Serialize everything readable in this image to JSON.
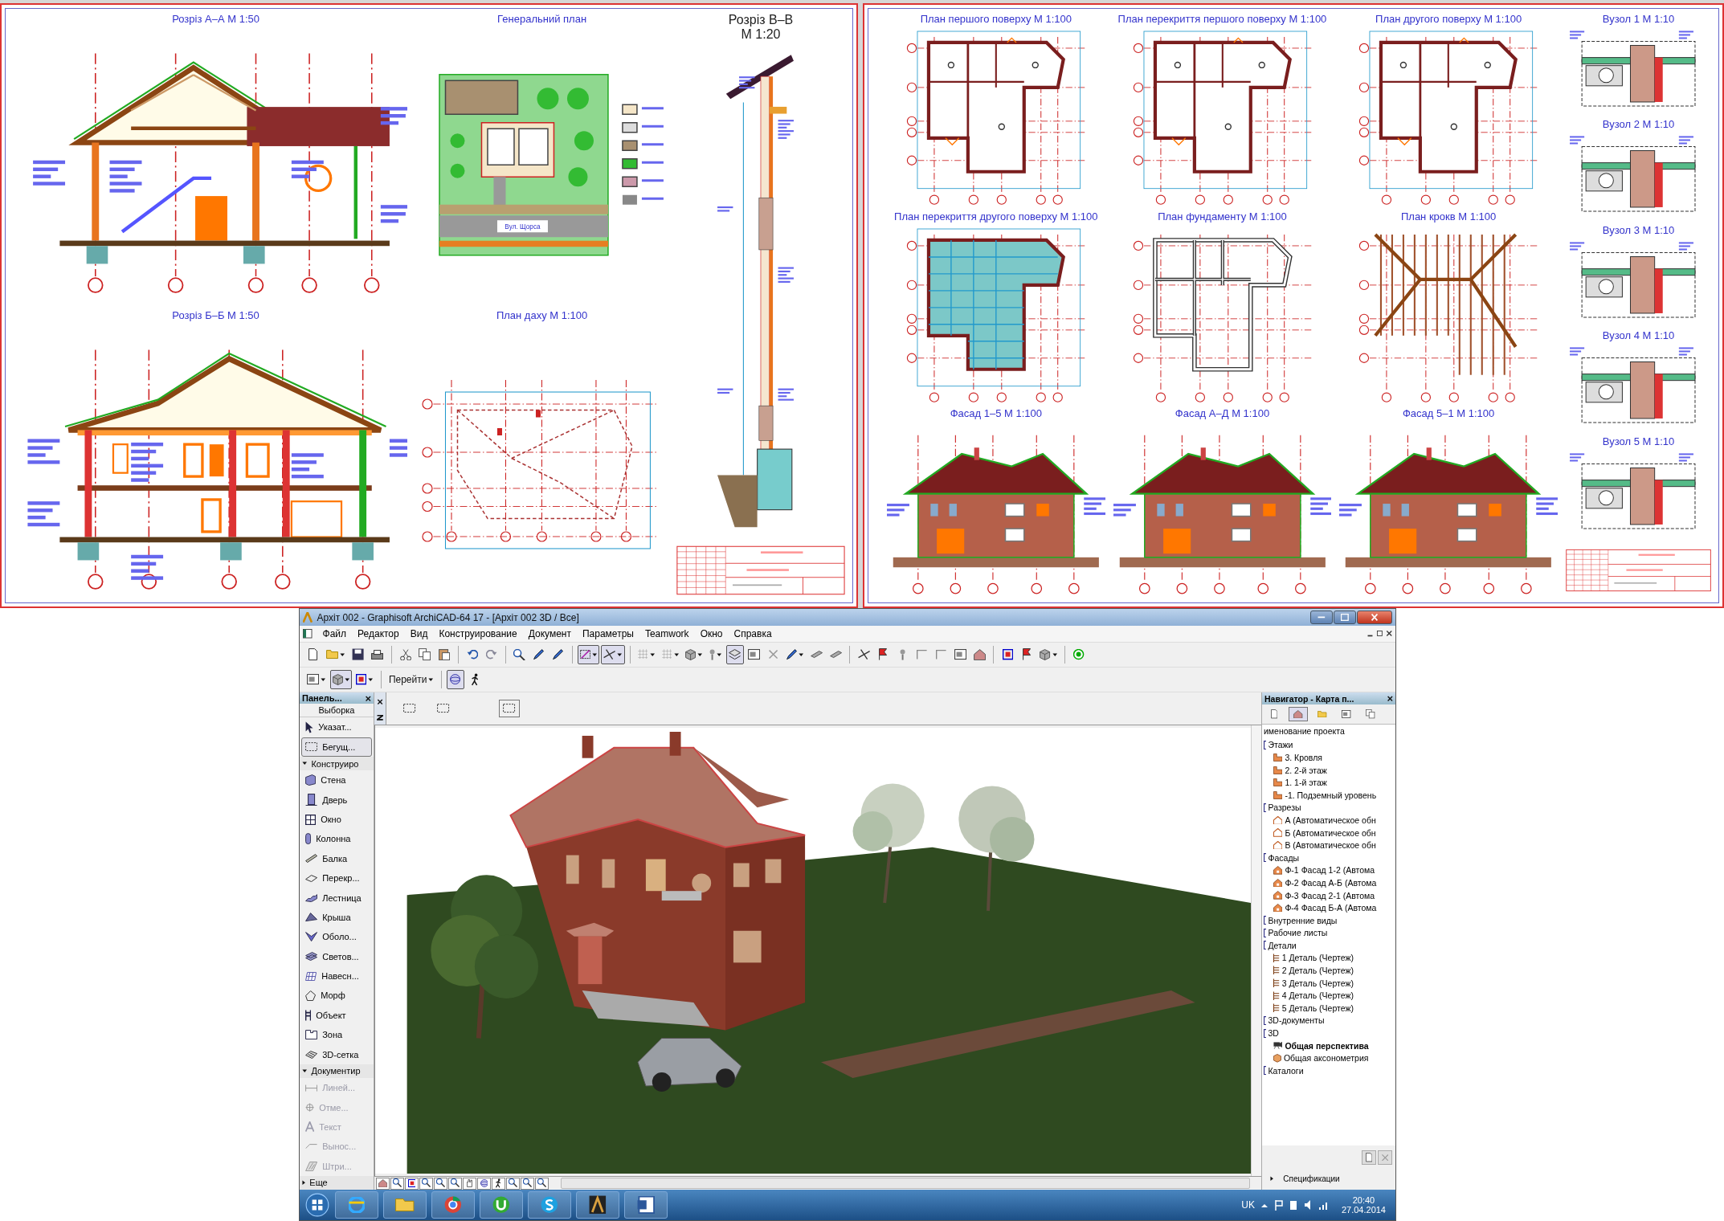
{
  "sheets": [
    {
      "columns": [
        [
          {
            "kind": "section",
            "title": "Розріз А–А  М 1:50"
          },
          {
            "kind": "section2",
            "title": "Розріз Б–Б  М 1:50"
          }
        ],
        [
          {
            "kind": "site",
            "title": "Генеральний план",
            "label": "Вул. Щорса"
          },
          {
            "kind": "roof-plan",
            "title": "План даху  М 1:100"
          }
        ],
        [
          {
            "kind": "wall-section",
            "title": "Розріз В–В",
            "subtitle": "М 1:20"
          },
          {
            "kind": "title-block"
          }
        ]
      ]
    },
    {
      "columns": [
        [
          {
            "kind": "plan",
            "title": "План першого поверху  М 1:100"
          },
          {
            "kind": "slab",
            "title": "План перекриття другого поверху  М 1:100"
          },
          {
            "kind": "facade",
            "title": "Фасад 1–5  М 1:100"
          }
        ],
        [
          {
            "kind": "plan",
            "title": "План перекриття першого поверху  М 1:100"
          },
          {
            "kind": "foundation",
            "title": "План фундаменту  М 1:100"
          },
          {
            "kind": "facade",
            "title": "Фасад А–Д  М 1:100"
          }
        ],
        [
          {
            "kind": "plan",
            "title": "План другого поверху  М 1:100"
          },
          {
            "kind": "rafters",
            "title": "План крокв М 1:100"
          },
          {
            "kind": "facade",
            "title": "Фасад 5–1  М 1:100"
          }
        ],
        [
          {
            "kind": "detail",
            "title": "Вузол 1  М 1:10"
          },
          {
            "kind": "detail",
            "title": "Вузол 2  М 1:10"
          },
          {
            "kind": "detail",
            "title": "Вузол 3  М 1:10"
          },
          {
            "kind": "detail",
            "title": "Вузол 4  М 1:10"
          },
          {
            "kind": "detail",
            "title": "Вузол 5  М 1:10"
          },
          {
            "kind": "title-block"
          }
        ]
      ]
    }
  ],
  "window": {
    "title": "Архіт 002 - Graphisoft ArchiCAD-64 17 - [Архіт 002 3D / Все]",
    "menu": [
      "Файл",
      "Редактор",
      "Вид",
      "Конструирование",
      "Документ",
      "Параметры",
      "Teamwork",
      "Окно",
      "Справка"
    ],
    "toolbar_1": [
      {
        "kind": "page"
      },
      {
        "kind": "folder",
        "dropdown": true
      },
      {
        "kind": "save"
      },
      {
        "kind": "printer"
      },
      {
        "kind": "sep"
      },
      {
        "kind": "scissors"
      },
      {
        "kind": "copy"
      },
      {
        "kind": "paste"
      },
      {
        "kind": "sep"
      },
      {
        "kind": "undo"
      },
      {
        "kind": "redo"
      },
      {
        "kind": "sep"
      },
      {
        "kind": "search"
      },
      {
        "kind": "pencil"
      },
      {
        "kind": "pencil"
      },
      {
        "kind": "sep"
      },
      {
        "kind": "wand",
        "pressed": true,
        "dropdown": true
      },
      {
        "kind": "trim",
        "pressed": true,
        "dropdown": true
      },
      {
        "kind": "sep"
      },
      {
        "kind": "grid",
        "dropdown": true
      },
      {
        "kind": "grid",
        "dropdown": true
      },
      {
        "kind": "cube",
        "dropdown": true
      },
      {
        "kind": "pin",
        "dropdown": true
      },
      {
        "kind": "layers",
        "pressed": true
      },
      {
        "kind": "panel"
      },
      {
        "kind": "cross"
      },
      {
        "kind": "pencil",
        "dropdown": true
      },
      {
        "kind": "beam"
      },
      {
        "kind": "beam"
      },
      {
        "kind": "sep"
      },
      {
        "kind": "trim"
      },
      {
        "kind": "flag"
      },
      {
        "kind": "pin"
      },
      {
        "kind": "corner"
      },
      {
        "kind": "corner"
      },
      {
        "kind": "panel"
      },
      {
        "kind": "house"
      },
      {
        "kind": "sep"
      },
      {
        "kind": "frame"
      },
      {
        "kind": "flag"
      },
      {
        "kind": "cube",
        "dropdown": true
      },
      {
        "kind": "sep"
      },
      {
        "kind": "target"
      }
    ],
    "toolbar_2": [
      {
        "kind": "panel",
        "dropdown": true
      },
      {
        "kind": "cube",
        "pressed": true,
        "dropdown": true
      },
      {
        "kind": "frame",
        "dropdown": true
      },
      {
        "kind": "sep"
      },
      {
        "kind": "label",
        "text": "Перейти",
        "dropdown": true
      },
      {
        "kind": "sep"
      },
      {
        "kind": "orbit",
        "pressed": true
      },
      {
        "kind": "walker"
      }
    ],
    "toolbox": {
      "title": "Панель...",
      "header": "Выборка",
      "items": [
        {
          "kind": "pointer",
          "label": "Указат...",
          "selected": false
        },
        {
          "kind": "marquee",
          "label": "Бегущ...",
          "selected": true
        }
      ],
      "groups": [
        {
          "label": "Конструиро",
          "expanded": true,
          "items": [
            {
              "kind": "wall",
              "label": "Стена",
              "disabled": false
            },
            {
              "kind": "door",
              "label": "Дверь",
              "disabled": false
            },
            {
              "kind": "window",
              "label": "Окно",
              "disabled": false
            },
            {
              "kind": "column",
              "label": "Колонна",
              "disabled": false
            },
            {
              "kind": "beam",
              "label": "Балка",
              "disabled": false
            },
            {
              "kind": "slab",
              "label": "Перекр...",
              "disabled": false
            },
            {
              "kind": "stair",
              "label": "Лестница",
              "disabled": false
            },
            {
              "kind": "roof",
              "label": "Крыша",
              "disabled": false
            },
            {
              "kind": "shell",
              "label": "Оболо...",
              "disabled": false
            },
            {
              "kind": "skylight",
              "label": "Светов...",
              "disabled": false
            },
            {
              "kind": "curtain",
              "label": "Навесн...",
              "disabled": false
            },
            {
              "kind": "morph",
              "label": "Морф",
              "disabled": false
            },
            {
              "kind": "object",
              "label": "Объект",
              "disabled": false
            },
            {
              "kind": "zone",
              "label": "Зона",
              "disabled": false
            },
            {
              "kind": "mesh",
              "label": "3D-сетка",
              "disabled": false
            }
          ]
        },
        {
          "label": "Документир",
          "expanded": true,
          "items": [
            {
              "kind": "dimension",
              "label": "Линей...",
              "disabled": true
            },
            {
              "kind": "level",
              "label": "Отме...",
              "disabled": true
            },
            {
              "kind": "text",
              "label": "Текст",
              "disabled": true
            },
            {
              "kind": "callout",
              "label": "Вынос...",
              "disabled": true
            },
            {
              "kind": "hatch",
              "label": "Штри...",
              "disabled": true
            }
          ]
        },
        {
          "label": "Еще",
          "expanded": false
        }
      ],
      "close": "×"
    },
    "info_close": "×",
    "selection_modes": [
      {
        "selected": false
      },
      {
        "selected": false
      },
      {
        "selected": true
      }
    ],
    "navigator_tabs": [
      {
        "kind": "page",
        "selected": false
      },
      {
        "kind": "house",
        "selected": true
      },
      {
        "kind": "folder",
        "selected": false
      },
      {
        "kind": "panel",
        "selected": false
      },
      {
        "kind": "copy",
        "selected": false
      }
    ],
    "navigator": {
      "title": "Навигатор - Карта п...",
      "close": "×",
      "root": "именование проекта",
      "tree": [
        {
          "label": "Этажи",
          "children": [
            {
              "label": "3. Кровля",
              "kind": "storey",
              "selected": false
            },
            {
              "label": "2. 2-й этаж",
              "kind": "storey",
              "selected": false
            },
            {
              "label": "1. 1-й этаж",
              "kind": "storey",
              "selected": false
            },
            {
              "label": "-1. Подземный уровень",
              "kind": "storey",
              "selected": false
            }
          ]
        },
        {
          "label": "Разрезы",
          "children": [
            {
              "label": "А (Автоматическое обн",
              "kind": "section",
              "selected": false
            },
            {
              "label": "Б (Автоматическое обн",
              "kind": "section",
              "selected": false
            },
            {
              "label": "В (Автоматическое обн",
              "kind": "section",
              "selected": false
            }
          ]
        },
        {
          "label": "Фасады",
          "children": [
            {
              "label": "Ф-1 Фасад 1-2 (Автома",
              "kind": "elevation",
              "selected": false
            },
            {
              "label": "Ф-2 Фасад А-Б (Автома",
              "kind": "elevation",
              "selected": false
            },
            {
              "label": "Ф-3 Фасад 2-1 (Автома",
              "kind": "elevation",
              "selected": false
            },
            {
              "label": "Ф-4 Фасад Б-А (Автома",
              "kind": "elevation",
              "selected": false
            }
          ]
        },
        {
          "label": "Внутренние виды"
        },
        {
          "label": "Рабочие листы"
        },
        {
          "label": "Детали",
          "children": [
            {
              "label": "1 Деталь (Чертеж)",
              "kind": "detail",
              "selected": false
            },
            {
              "label": "2 Деталь (Чертеж)",
              "kind": "detail",
              "selected": false
            },
            {
              "label": "3 Деталь (Чертеж)",
              "kind": "detail",
              "selected": false
            },
            {
              "label": "4 Деталь (Чертеж)",
              "kind": "detail",
              "selected": false
            },
            {
              "label": "5 Деталь (Чертеж)",
              "kind": "detail",
              "selected": false
            }
          ]
        },
        {
          "label": "3D-документы"
        },
        {
          "label": "3D",
          "children": [
            {
              "label": "Общая перспектива",
              "kind": "camera",
              "selected": true
            },
            {
              "label": "Общая аксонометрия",
              "kind": "box",
              "selected": false
            }
          ]
        },
        {
          "label": "Каталоги"
        }
      ],
      "footer": "Спецификации"
    }
  },
  "taskbar": {
    "apps": [
      {
        "kind": "browser"
      },
      {
        "kind": "folder"
      },
      {
        "kind": "globe"
      },
      {
        "kind": "torrent"
      },
      {
        "kind": "chat"
      },
      {
        "kind": "archicad"
      },
      {
        "kind": "document"
      }
    ],
    "language": "UK",
    "time": "20:40",
    "date": "27.04.2014"
  }
}
